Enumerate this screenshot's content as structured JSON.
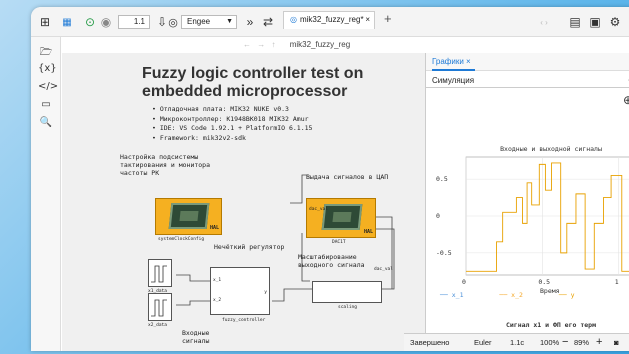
{
  "toolbar": {
    "time_value": "1.1",
    "solver_select": "Engee",
    "tab_label": "mik32_fuzzy_reg",
    "tab_modified": "*"
  },
  "address": {
    "path": "mik32_fuzzy_reg"
  },
  "canvas": {
    "title": "Fuzzy logic controller test on embedded microprocessor",
    "bullets": [
      "Отладочная плата: MIK32 NUKE v0.3",
      "Микроконтроллер: K1948BK018 MIK32 Amur",
      "IDE: VS Code 1.92.1 + PlatformIO 6.1.15",
      "Framework: mik32v2-sdk"
    ],
    "label_clock": "Настройка подсистемы тактирования и монитора частоты РК",
    "label_dac": "Выдача сигналов в ЦАП",
    "label_fuzzy": "Нечёткий регулятор",
    "label_scaling": "Масштабирование выходного сигнала",
    "label_inputs": "Входные сигналы",
    "block_sysclock": "systemClockConfig",
    "block_dac": "DAC1T",
    "block_fuzzy": "fuzzy_controller",
    "block_scaling": "scaling",
    "block_x1": "x1_data",
    "block_x2": "x2_data",
    "port_dac_val": "dac_val",
    "port_x1": "x_1",
    "port_x2": "x_2",
    "port_y": "y",
    "chip_hal": "HAL",
    "chip_hal2": "HAL"
  },
  "panel": {
    "tab_label": "Графики",
    "subtab_label": "Симуляция",
    "plot_title": "Входные и выходной сигналы",
    "plot2_title": "Сигнал x1 и ФП его терм",
    "xlabel": "Время"
  },
  "chart_data": {
    "type": "line",
    "title": "Входные и выходной сигналы",
    "xlabel": "Время",
    "ylabel": "",
    "xlim": [
      0,
      1.1
    ],
    "ylim": [
      -0.8,
      0.8
    ],
    "yticks": [
      "0.5",
      "0",
      "-0.5"
    ],
    "xticks": [
      "0",
      "0.5",
      "1"
    ],
    "series": [
      {
        "name": "x_1",
        "color": "#4a90d9",
        "x": [],
        "y": []
      },
      {
        "name": "x_2",
        "color": "#f5a623",
        "x": [],
        "y": []
      },
      {
        "name": "y",
        "color": "#e8a100",
        "x": [
          0,
          0.2,
          0.2,
          0.24,
          0.24,
          0.33,
          0.33,
          0.37,
          0.37,
          0.4,
          0.4,
          0.43,
          0.43,
          0.48,
          0.48,
          0.52,
          0.52,
          0.56,
          0.56,
          0.62,
          0.62,
          0.66,
          0.66,
          0.72,
          0.72,
          0.78,
          0.78,
          0.84,
          0.84,
          0.9,
          0.9,
          0.95,
          0.95,
          1.02,
          1.02,
          1.1
        ],
        "y": [
          -0.75,
          -0.75,
          -0.35,
          -0.35,
          0.05,
          0.05,
          0.25,
          0.25,
          -0.1,
          -0.1,
          0.45,
          0.45,
          0.15,
          0.15,
          0.7,
          0.7,
          0.35,
          0.35,
          0.72,
          0.72,
          -0.5,
          -0.5,
          -0.1,
          -0.1,
          0.3,
          0.3,
          -0.72,
          -0.72,
          -0.1,
          -0.1,
          0.25,
          0.25,
          0.55,
          0.55,
          -0.75,
          -0.75
        ]
      }
    ]
  },
  "status": {
    "state": "Завершено",
    "solver": "Euler",
    "time": "1.1с",
    "progress": "100%",
    "zoom": "89%"
  }
}
